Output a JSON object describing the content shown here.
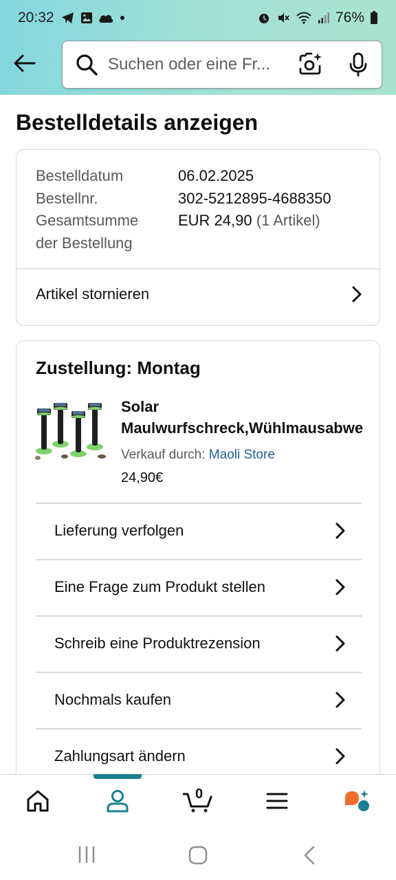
{
  "status_bar": {
    "time": "20:32",
    "battery": "76%"
  },
  "header": {
    "search_placeholder": "Suchen oder eine Fr..."
  },
  "page": {
    "title": "Bestelldetails anzeigen"
  },
  "order_summary": {
    "rows": [
      {
        "label": "Bestelldatum",
        "value": "06.02.2025"
      },
      {
        "label": "Bestellnr.",
        "value": "302-5212895-4688350"
      }
    ],
    "total_label_line1": "Gesamtsumme",
    "total_label_line2": "der Bestellung",
    "total_value": "EUR 24,90",
    "total_items": "(1 Artikel)",
    "cancel_link": "Artikel stornieren"
  },
  "delivery": {
    "title": "Zustellung: Montag",
    "product": {
      "name_line1": "Solar",
      "name_line2": "Maulwurfschreck,Wühlmausabwehr",
      "sold_by_label": "Verkauf durch: ",
      "seller": "Maoli Store",
      "price": "24,90€"
    },
    "actions": [
      {
        "label": "Lieferung verfolgen"
      },
      {
        "label": "Eine Frage zum Produkt stellen"
      },
      {
        "label": "Schreib eine Produktrezension"
      },
      {
        "label": "Nochmals kaufen"
      },
      {
        "label": "Zahlungsart ändern"
      }
    ]
  },
  "bottom_nav": {
    "items": [
      "home-icon",
      "account-icon",
      "cart-icon",
      "menu-icon",
      "rufus-icon"
    ],
    "active": "account-icon",
    "cart_count": "0",
    "accent_color": "#1a7f8e"
  }
}
